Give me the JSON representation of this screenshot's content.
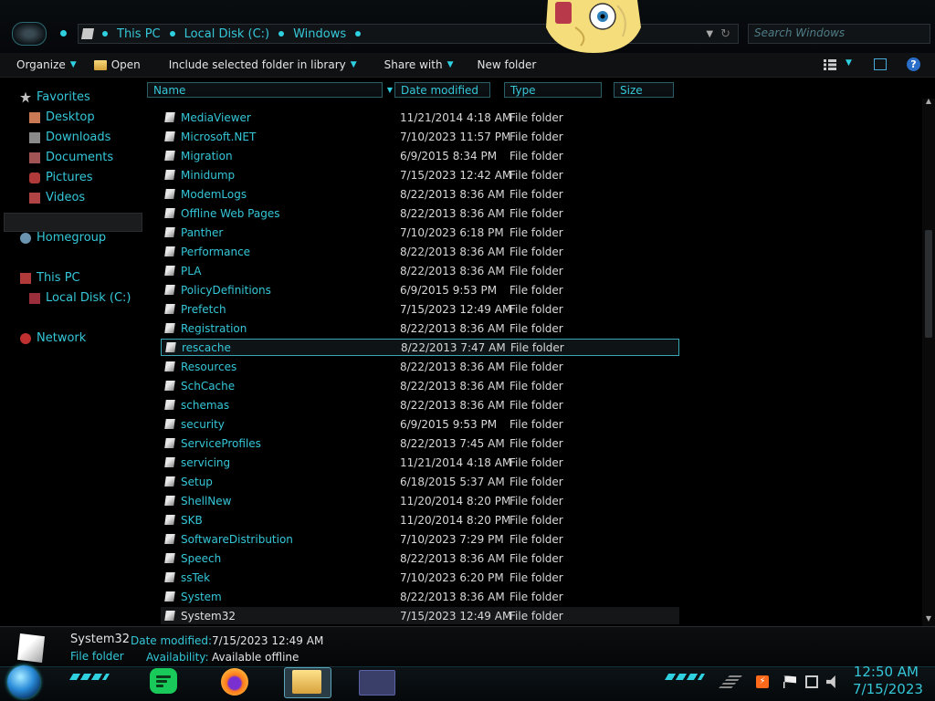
{
  "address": {
    "crumbs": [
      "This PC",
      "Local Disk (C:)",
      "Windows"
    ],
    "search_placeholder": "Search Windows"
  },
  "toolbar": {
    "organize": "Organize",
    "open": "Open",
    "include": "Include selected folder in library",
    "share": "Share with",
    "new_folder": "New folder"
  },
  "nav": {
    "favorites": "Favorites",
    "desktop": "Desktop",
    "downloads": "Downloads",
    "documents": "Documents",
    "pictures": "Pictures",
    "videos": "Videos",
    "homegroup": "Homegroup",
    "this_pc": "This PC",
    "local_disk": "Local Disk (C:)",
    "network": "Network"
  },
  "columns": {
    "name": "Name",
    "date": "Date modified",
    "type": "Type",
    "size": "Size"
  },
  "files": [
    {
      "name": "MediaViewer",
      "date": "11/21/2014 4:18 AM",
      "type": "File folder"
    },
    {
      "name": "Microsoft.NET",
      "date": "7/10/2023 11:57 PM",
      "type": "File folder"
    },
    {
      "name": "Migration",
      "date": "6/9/2015 8:34 PM",
      "type": "File folder"
    },
    {
      "name": "Minidump",
      "date": "7/15/2023 12:42 AM",
      "type": "File folder"
    },
    {
      "name": "ModemLogs",
      "date": "8/22/2013 8:36 AM",
      "type": "File folder"
    },
    {
      "name": "Offline Web Pages",
      "date": "8/22/2013 8:36 AM",
      "type": "File folder"
    },
    {
      "name": "Panther",
      "date": "7/10/2023 6:18 PM",
      "type": "File folder"
    },
    {
      "name": "Performance",
      "date": "8/22/2013 8:36 AM",
      "type": "File folder"
    },
    {
      "name": "PLA",
      "date": "8/22/2013 8:36 AM",
      "type": "File folder"
    },
    {
      "name": "PolicyDefinitions",
      "date": "6/9/2015 9:53 PM",
      "type": "File folder"
    },
    {
      "name": "Prefetch",
      "date": "7/15/2023 12:49 AM",
      "type": "File folder"
    },
    {
      "name": "Registration",
      "date": "8/22/2013 8:36 AM",
      "type": "File folder"
    },
    {
      "name": "rescache",
      "date": "8/22/2013 7:47 AM",
      "type": "File folder"
    },
    {
      "name": "Resources",
      "date": "8/22/2013 8:36 AM",
      "type": "File folder"
    },
    {
      "name": "SchCache",
      "date": "8/22/2013 8:36 AM",
      "type": "File folder"
    },
    {
      "name": "schemas",
      "date": "8/22/2013 8:36 AM",
      "type": "File folder"
    },
    {
      "name": "security",
      "date": "6/9/2015 9:53 PM",
      "type": "File folder"
    },
    {
      "name": "ServiceProfiles",
      "date": "8/22/2013 7:45 AM",
      "type": "File folder"
    },
    {
      "name": "servicing",
      "date": "11/21/2014 4:18 AM",
      "type": "File folder"
    },
    {
      "name": "Setup",
      "date": "6/18/2015 5:37 AM",
      "type": "File folder"
    },
    {
      "name": "ShellNew",
      "date": "11/20/2014 8:20 PM",
      "type": "File folder"
    },
    {
      "name": "SKB",
      "date": "11/20/2014 8:20 PM",
      "type": "File folder"
    },
    {
      "name": "SoftwareDistribution",
      "date": "7/10/2023 7:29 PM",
      "type": "File folder"
    },
    {
      "name": "Speech",
      "date": "8/22/2013 8:36 AM",
      "type": "File folder"
    },
    {
      "name": "ssTek",
      "date": "7/10/2023 6:20 PM",
      "type": "File folder"
    },
    {
      "name": "System",
      "date": "8/22/2013 8:36 AM",
      "type": "File folder"
    },
    {
      "name": "System32",
      "date": "7/15/2023 12:49 AM",
      "type": "File folder"
    }
  ],
  "details": {
    "name": "System32",
    "kind": "File folder",
    "date_label": "Date modified:",
    "date_value": "7/15/2023 12:49 AM",
    "avail_label": "Availability:",
    "avail_value": "Available offline"
  },
  "clock": {
    "time": "12:50 AM",
    "date": "7/15/2023"
  },
  "colors": {
    "accent": "#35c7d8",
    "background": "#000000",
    "selection_border": "#3aa8b4"
  }
}
